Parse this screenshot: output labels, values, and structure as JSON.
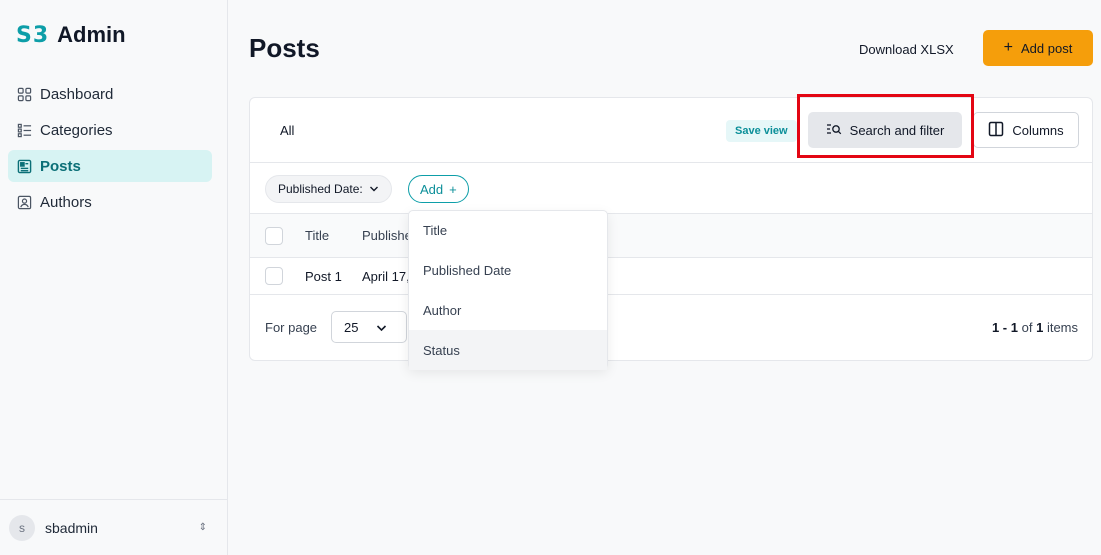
{
  "app": {
    "logo_mark": "S3",
    "logo_text": "Admin"
  },
  "sidebar": {
    "items": [
      {
        "label": "Dashboard",
        "icon": "grid-icon",
        "active": false
      },
      {
        "label": "Categories",
        "icon": "list-icon",
        "active": false
      },
      {
        "label": "Posts",
        "icon": "newspaper-icon",
        "active": true
      },
      {
        "label": "Authors",
        "icon": "user-card-icon",
        "active": false
      }
    ],
    "user": {
      "avatar_initial": "s",
      "name": "sbadmin",
      "toggle": "⇕"
    }
  },
  "header": {
    "title": "Posts",
    "download_label": "Download XLSX",
    "add_post_label": "Add post",
    "add_post_icon": "+"
  },
  "toolbar": {
    "tab_all": "All",
    "save_view": "Save view",
    "search_filter": "Search and filter",
    "columns": "Columns"
  },
  "filters": {
    "chip_label": "Published Date:",
    "add_label": "Add",
    "add_icon": "+"
  },
  "table": {
    "headers": [
      "Title",
      "Publishe"
    ],
    "rows": [
      {
        "title": "Post 1",
        "published": "April 17,"
      }
    ]
  },
  "pagination": {
    "per_page_label": "For page",
    "per_page_value": "25",
    "range": "1 - 1",
    "of": "of",
    "total": "1",
    "items_label": "items"
  },
  "dropdown": {
    "items": [
      "Title",
      "Published Date",
      "Author",
      "Status"
    ],
    "hovered_index": 3
  },
  "colors": {
    "accent": "#0d9ea8",
    "primary_button": "#f59e0b",
    "active_nav_bg": "#d7f3f3",
    "highlight": "#e30613"
  }
}
